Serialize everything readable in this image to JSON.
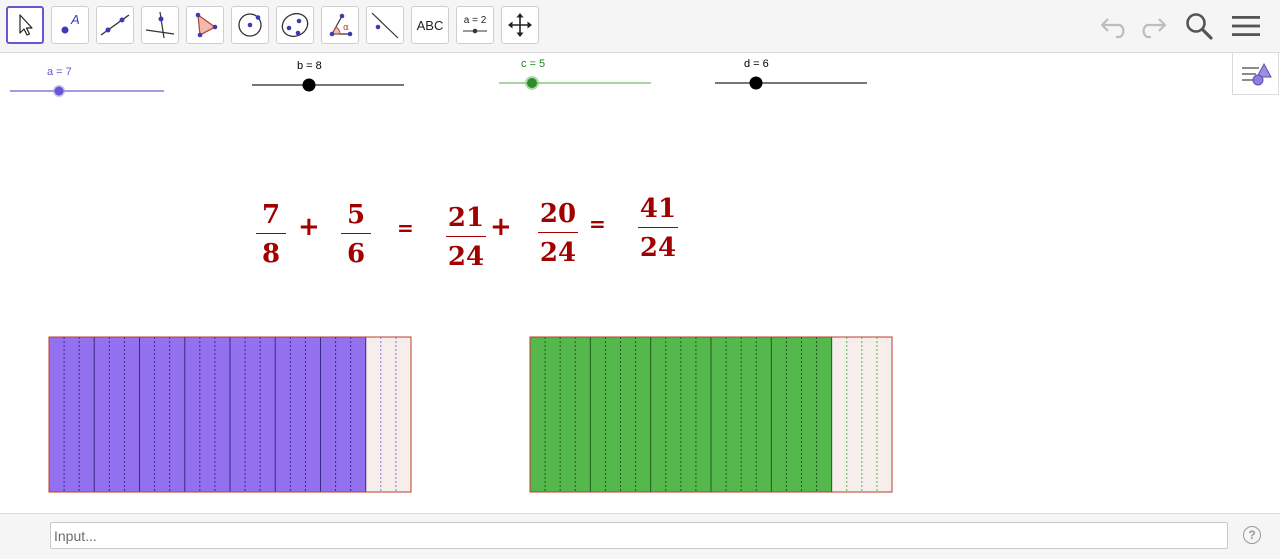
{
  "toolbar": {
    "tools": [
      {
        "name": "move-tool",
        "icon": "arrow-pointer-icon"
      },
      {
        "name": "point-tool",
        "icon": "point-icon",
        "glyph": "A"
      },
      {
        "name": "line-tool",
        "icon": "line-icon"
      },
      {
        "name": "perpendicular-line-tool",
        "icon": "perpendicular-icon"
      },
      {
        "name": "polygon-tool",
        "icon": "polygon-icon"
      },
      {
        "name": "circle-tool",
        "icon": "circle-icon"
      },
      {
        "name": "conic-tool",
        "icon": "ellipse-icon"
      },
      {
        "name": "angle-tool",
        "icon": "angle-icon",
        "glyph": "α"
      },
      {
        "name": "reflect-tool",
        "icon": "reflect-icon"
      },
      {
        "name": "text-tool",
        "icon": "text-icon",
        "label": "ABC"
      },
      {
        "name": "slider-tool",
        "icon": "slider-icon",
        "label": "a = 2"
      },
      {
        "name": "move-graphics-view-tool",
        "icon": "move-cross-icon"
      }
    ],
    "undo_icon": "undo-icon",
    "redo_icon": "redo-icon",
    "search_icon": "search-icon",
    "menu_icon": "hamburger-menu-icon"
  },
  "sliders": [
    {
      "label": "a = 7",
      "value": 7,
      "color": "#6557d2",
      "knob_color": "#6557d2",
      "track_color": "#a49be4"
    },
    {
      "label": "b = 8",
      "value": 8,
      "color": "#000000",
      "knob_color": "#000000",
      "track_color": "#777777"
    },
    {
      "label": "c = 5",
      "value": 5,
      "color": "#1b8c1b",
      "knob_color": "#2e8b2e",
      "track_color": "#a5d69d"
    },
    {
      "label": "d = 6",
      "value": 6,
      "color": "#000000",
      "knob_color": "#000000",
      "track_color": "#777777"
    }
  ],
  "equation": {
    "frac1": {
      "num": "7",
      "den": "8"
    },
    "op1": "+",
    "frac2": {
      "num": "5",
      "den": "6"
    },
    "eq1": "=",
    "frac3": {
      "num": "21",
      "den": "24"
    },
    "op2": "+",
    "frac4": {
      "num": "20",
      "den": "24"
    },
    "eq2": "=",
    "frac5": {
      "num": "41",
      "den": "24"
    },
    "color": "#a00000"
  },
  "bars": [
    {
      "numerator": 7,
      "denominator": 8,
      "sub_parts": 3,
      "fill": "#9370ed",
      "empty_fill": "#f6eeea",
      "border": "#c0392b",
      "line": "#3a2a8a"
    },
    {
      "numerator": 5,
      "denominator": 6,
      "sub_parts": 4,
      "fill": "#55b84d",
      "empty_fill": "#f6eeea",
      "border": "#c0392b",
      "line": "#1e5e1a"
    }
  ],
  "input": {
    "placeholder": "Input..."
  },
  "help_icon": "help-icon",
  "help_glyph": "?",
  "stylebar_icon": "graphics-stylebar-icon"
}
